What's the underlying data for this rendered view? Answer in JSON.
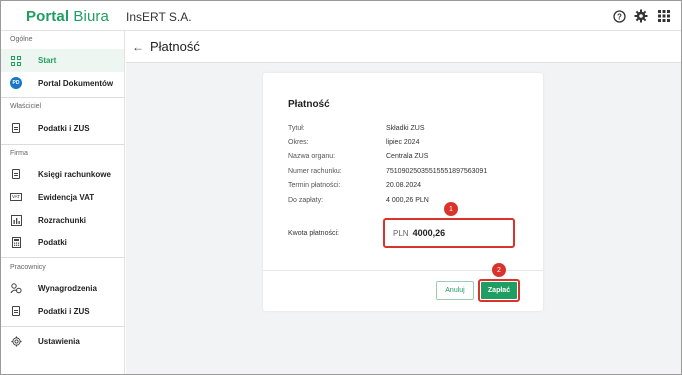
{
  "app": {
    "logo_part1": "Portal",
    "logo_part2": "Biura",
    "company": "InsERT S.A."
  },
  "topbar_icons": [
    "help-icon",
    "gear-icon",
    "apps-grid-icon"
  ],
  "sidebar": {
    "sections": [
      {
        "title": "Ogólne",
        "items": [
          {
            "label": "Start",
            "icon": "dashboard-icon",
            "active": true
          },
          {
            "label": "Portal Dokumentów",
            "icon": "pd-badge-icon",
            "badge": "PD"
          }
        ]
      },
      {
        "title": "Właściciel",
        "items": [
          {
            "label": "Podatki i ZUS",
            "icon": "document-icon"
          }
        ]
      },
      {
        "title": "Firma",
        "items": [
          {
            "label": "Księgi rachunkowe",
            "icon": "ledger-icon"
          },
          {
            "label": "Ewidencja VAT",
            "icon": "vat-icon",
            "icon_text": "VAT"
          },
          {
            "label": "Rozrachunki",
            "icon": "chart-icon"
          },
          {
            "label": "Podatki",
            "icon": "calculator-icon"
          }
        ]
      },
      {
        "title": "Pracownicy",
        "items": [
          {
            "label": "Wynagrodzenia",
            "icon": "salary-icon"
          },
          {
            "label": "Podatki i ZUS",
            "icon": "document-icon"
          }
        ]
      }
    ],
    "settings_label": "Ustawienia"
  },
  "page": {
    "back_arrow": "←",
    "title": "Płatność"
  },
  "card": {
    "title": "Płatność",
    "rows": [
      {
        "label": "Tytuł:",
        "value": "Składki ZUS"
      },
      {
        "label": "Okres:",
        "value": "lipiec 2024"
      },
      {
        "label": "Nazwa organu:",
        "value": "Centrala ZUS"
      },
      {
        "label": "Numer rachunku:",
        "value": "75109025035515551897563091"
      },
      {
        "label": "Termin płatności:",
        "value": "20.08.2024"
      },
      {
        "label": "Do zapłaty:",
        "value": "4 000,26 PLN"
      }
    ],
    "amount_label": "Kwota płatności:",
    "amount_currency": "PLN",
    "amount_value": "4000,26",
    "cancel_label": "Anuluj",
    "pay_label": "Zapłać"
  },
  "annotations": {
    "step1": "1",
    "step2": "2"
  },
  "colors": {
    "brand": "#1f9e63",
    "highlight": "#d9342b",
    "badge_blue": "#1877c9"
  }
}
